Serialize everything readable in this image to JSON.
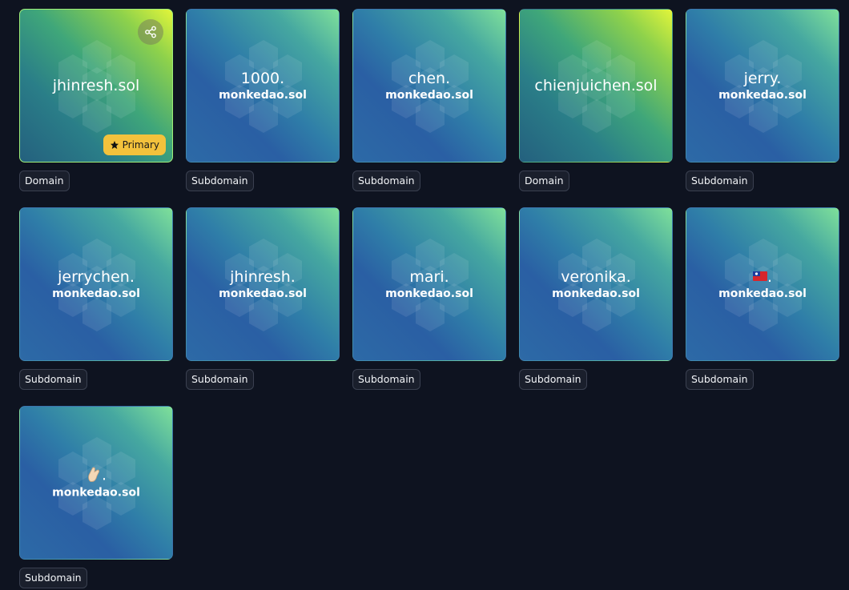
{
  "cards": [
    {
      "name": "jhinresh.sol",
      "parent": "",
      "type": "Domain",
      "primary_label": "Primary"
    },
    {
      "name": "1000.",
      "parent": "monkedao.sol",
      "type": "Subdomain"
    },
    {
      "name": "chen.",
      "parent": "monkedao.sol",
      "type": "Subdomain"
    },
    {
      "name": "chienjuichen.sol",
      "parent": "",
      "type": "Domain"
    },
    {
      "name": "jerry.",
      "parent": "monkedao.sol",
      "type": "Subdomain"
    },
    {
      "name": "jerrychen.",
      "parent": "monkedao.sol",
      "type": "Subdomain"
    },
    {
      "name": "jhinresh.",
      "parent": "monkedao.sol",
      "type": "Subdomain"
    },
    {
      "name": "mari.",
      "parent": "monkedao.sol",
      "type": "Subdomain"
    },
    {
      "name": "veronika.",
      "parent": "monkedao.sol",
      "type": "Subdomain"
    },
    {
      "name": ".",
      "parent": "monkedao.sol",
      "type": "Subdomain",
      "emoji": "taiwan-flag-icon"
    },
    {
      "name": ".",
      "parent": "monkedao.sol",
      "type": "Subdomain",
      "emoji": "pinched-fingers-hand-icon"
    }
  ],
  "colors": {
    "background": "#0e1320",
    "primary_badge": "#f3c23c",
    "selected_border": "#9ff07a"
  }
}
